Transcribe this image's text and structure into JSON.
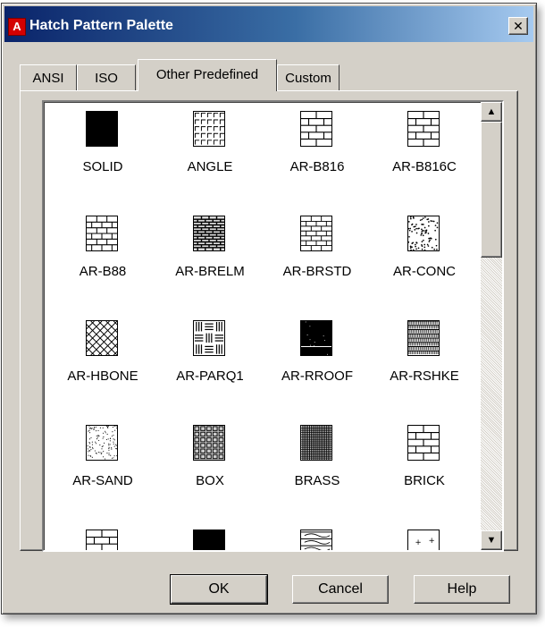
{
  "window": {
    "title": "Hatch Pattern Palette",
    "app_icon_glyph": "A",
    "close_glyph": "✕"
  },
  "tabs": [
    {
      "label": "ANSI",
      "active": false
    },
    {
      "label": "ISO",
      "active": false
    },
    {
      "label": "Other Predefined",
      "active": true
    },
    {
      "label": "Custom",
      "active": false
    }
  ],
  "patterns": [
    {
      "label": "SOLID",
      "icon": "solid-fill-icon"
    },
    {
      "label": "ANGLE",
      "icon": "angle-grid-icon"
    },
    {
      "label": "AR-B816",
      "icon": "brick-large-icon"
    },
    {
      "label": "AR-B816C",
      "icon": "brick-large-icon"
    },
    {
      "label": "AR-B88",
      "icon": "brick-grid-icon"
    },
    {
      "label": "AR-BRELM",
      "icon": "brick-elevation-icon"
    },
    {
      "label": "AR-BRSTD",
      "icon": "brick-standard-icon"
    },
    {
      "label": "AR-CONC",
      "icon": "concrete-icon"
    },
    {
      "label": "AR-HBONE",
      "icon": "herringbone-icon"
    },
    {
      "label": "AR-PARQ1",
      "icon": "parquet-icon"
    },
    {
      "label": "AR-RROOF",
      "icon": "roof-icon"
    },
    {
      "label": "AR-RSHKE",
      "icon": "shake-roof-icon"
    },
    {
      "label": "AR-SAND",
      "icon": "sand-icon"
    },
    {
      "label": "BOX",
      "icon": "box-icon"
    },
    {
      "label": "BRASS",
      "icon": "brass-icon"
    },
    {
      "label": "BRICK",
      "icon": "brick-icon"
    },
    {
      "label": "",
      "icon": "brick-partial-icon"
    },
    {
      "label": "",
      "icon": "solid-partial-icon"
    },
    {
      "label": "",
      "icon": "wave-partial-icon"
    },
    {
      "label": "",
      "icon": "dots-partial-icon"
    }
  ],
  "scrollbar": {
    "up_glyph": "▲",
    "down_glyph": "▼",
    "position_fraction": 0.0
  },
  "buttons": {
    "ok": "OK",
    "cancel": "Cancel",
    "help": "Help"
  },
  "colors": {
    "title_start": "#0a246a",
    "title_end": "#a6caf0",
    "face": "#d4d0c8"
  }
}
